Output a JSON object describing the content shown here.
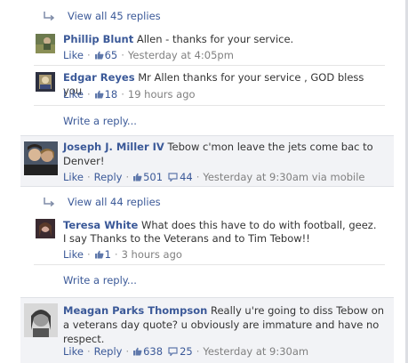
{
  "thread1": {
    "view_all": "View all 45 replies",
    "replies": [
      {
        "name": "Phillip Blunt",
        "text": "Allen - thanks for your service.",
        "like": "Like",
        "likes": "65",
        "time": "Yesterday at 4:05pm"
      },
      {
        "name": "Edgar Reyes",
        "text": "Mr Allen thanks for your service , GOD bless you",
        "like": "Like",
        "likes": "18",
        "time": "19 hours ago"
      }
    ],
    "write_reply": "Write a reply..."
  },
  "comment1": {
    "name": "Joseph J. Miller IV",
    "text": "Tebow c'mon leave the jets come bac to Denver!",
    "like": "Like",
    "reply": "Reply",
    "likes": "501",
    "replies": "44",
    "time": "Yesterday at 9:30am via mobile"
  },
  "thread2": {
    "view_all": "View all 44 replies",
    "replies": [
      {
        "name": "Teresa White",
        "text": "What does this have to do with football, geez. I say Thanks to the Veterans and to Tim Tebow!!",
        "like": "Like",
        "likes": "1",
        "time": "3 hours ago"
      }
    ],
    "write_reply": "Write a reply..."
  },
  "comment2": {
    "name": "Meagan Parks Thompson",
    "text": "Really u're going to diss Tebow on a veterans day quote? u obviously are immature and have no respect.",
    "like": "Like",
    "reply": "Reply",
    "likes": "638",
    "replies": "25",
    "time": "Yesterday at 9:30am"
  },
  "colors": {
    "link": "#3b5998",
    "muted": "#808080",
    "comment_bg": "#f2f3f6"
  },
  "icons": [
    "reply-thread-icon",
    "thumbs-up-icon",
    "speech-bubble-icon"
  ]
}
